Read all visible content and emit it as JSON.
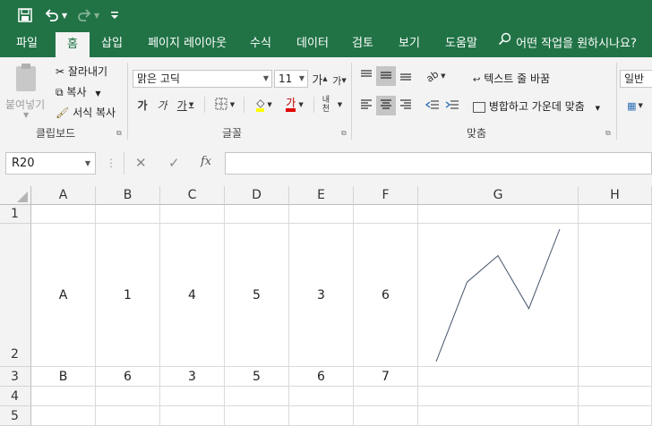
{
  "qat": {
    "save_icon": "save-icon",
    "undo_icon": "undo-icon",
    "redo_icon": "redo-icon",
    "customize_icon": "customize-qat-icon"
  },
  "tabs": [
    {
      "label": "파일"
    },
    {
      "label": "홈"
    },
    {
      "label": "삽입"
    },
    {
      "label": "페이지 레이아웃"
    },
    {
      "label": "수식"
    },
    {
      "label": "데이터"
    },
    {
      "label": "검토"
    },
    {
      "label": "보기"
    },
    {
      "label": "도움말"
    }
  ],
  "tell_me": "어떤 작업을 원하시나요?",
  "clipboard": {
    "paste": "붙여넣기",
    "cut": "잘라내기",
    "copy": "복사",
    "format_painter": "서식 복사",
    "group": "클립보드"
  },
  "font": {
    "name": "맑은 고딕",
    "size": "11",
    "grow": "가",
    "shrink": "가",
    "bold": "가",
    "italic": "가",
    "underline": "가",
    "font_color_glyph": "가",
    "phonetic": "내천",
    "group": "글꼴"
  },
  "alignment": {
    "wrap_text": "텍스트 줄 바꿈",
    "merge_center": "병합하고 가운데 맞춤",
    "group": "맞춤"
  },
  "number": {
    "format": "일반"
  },
  "formula_bar": {
    "name_box": "R20",
    "cancel": "✕",
    "enter": "✓",
    "fx": "fx",
    "formula": ""
  },
  "columns": [
    "A",
    "B",
    "C",
    "D",
    "E",
    "F",
    "G",
    "H"
  ],
  "rows": [
    {
      "num": "1",
      "cells": [
        "",
        "",
        "",
        "",
        "",
        ""
      ]
    },
    {
      "num": "2",
      "cells": [
        "A",
        "1",
        "4",
        "5",
        "3",
        "6"
      ]
    },
    {
      "num": "3",
      "cells": [
        "B",
        "6",
        "3",
        "5",
        "6",
        "7"
      ]
    },
    {
      "num": "4",
      "cells": [
        "",
        "",
        "",
        "",
        "",
        ""
      ]
    },
    {
      "num": "5",
      "cells": [
        "",
        "",
        "",
        "",
        "",
        ""
      ]
    }
  ],
  "sparkline": {
    "values": [
      1,
      4,
      5,
      3,
      6
    ],
    "color": "#44546a"
  },
  "colors": {
    "accent": "#217346"
  }
}
